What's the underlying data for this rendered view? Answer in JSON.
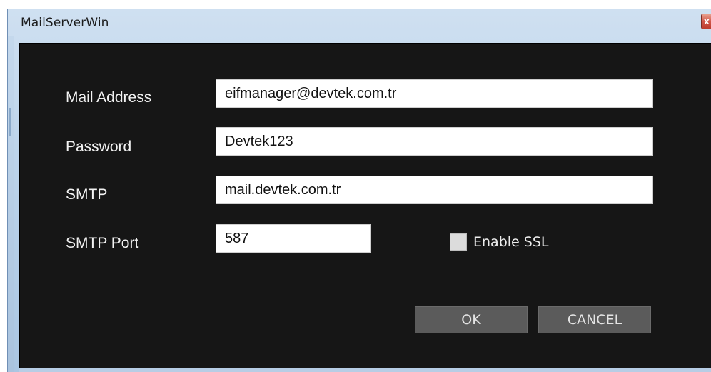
{
  "window": {
    "title": "MailServerWin",
    "close_symbol": "x"
  },
  "form": {
    "mail_address": {
      "label": "Mail Address",
      "value": "eifmanager@devtek.com.tr"
    },
    "password": {
      "label": "Password",
      "value": "Devtek123"
    },
    "smtp": {
      "label": "SMTP",
      "value": "mail.devtek.com.tr"
    },
    "smtp_port": {
      "label": "SMTP Port",
      "value": "587"
    },
    "enable_ssl": {
      "label": "Enable SSL",
      "checked": false
    }
  },
  "buttons": {
    "ok": "OK",
    "cancel": "CANCEL"
  },
  "colors": {
    "dialog_background": "#161616",
    "button_background": "#5b5b5b",
    "titlebar": "#bcd3ea"
  },
  "icons": {
    "close": "close-icon"
  }
}
